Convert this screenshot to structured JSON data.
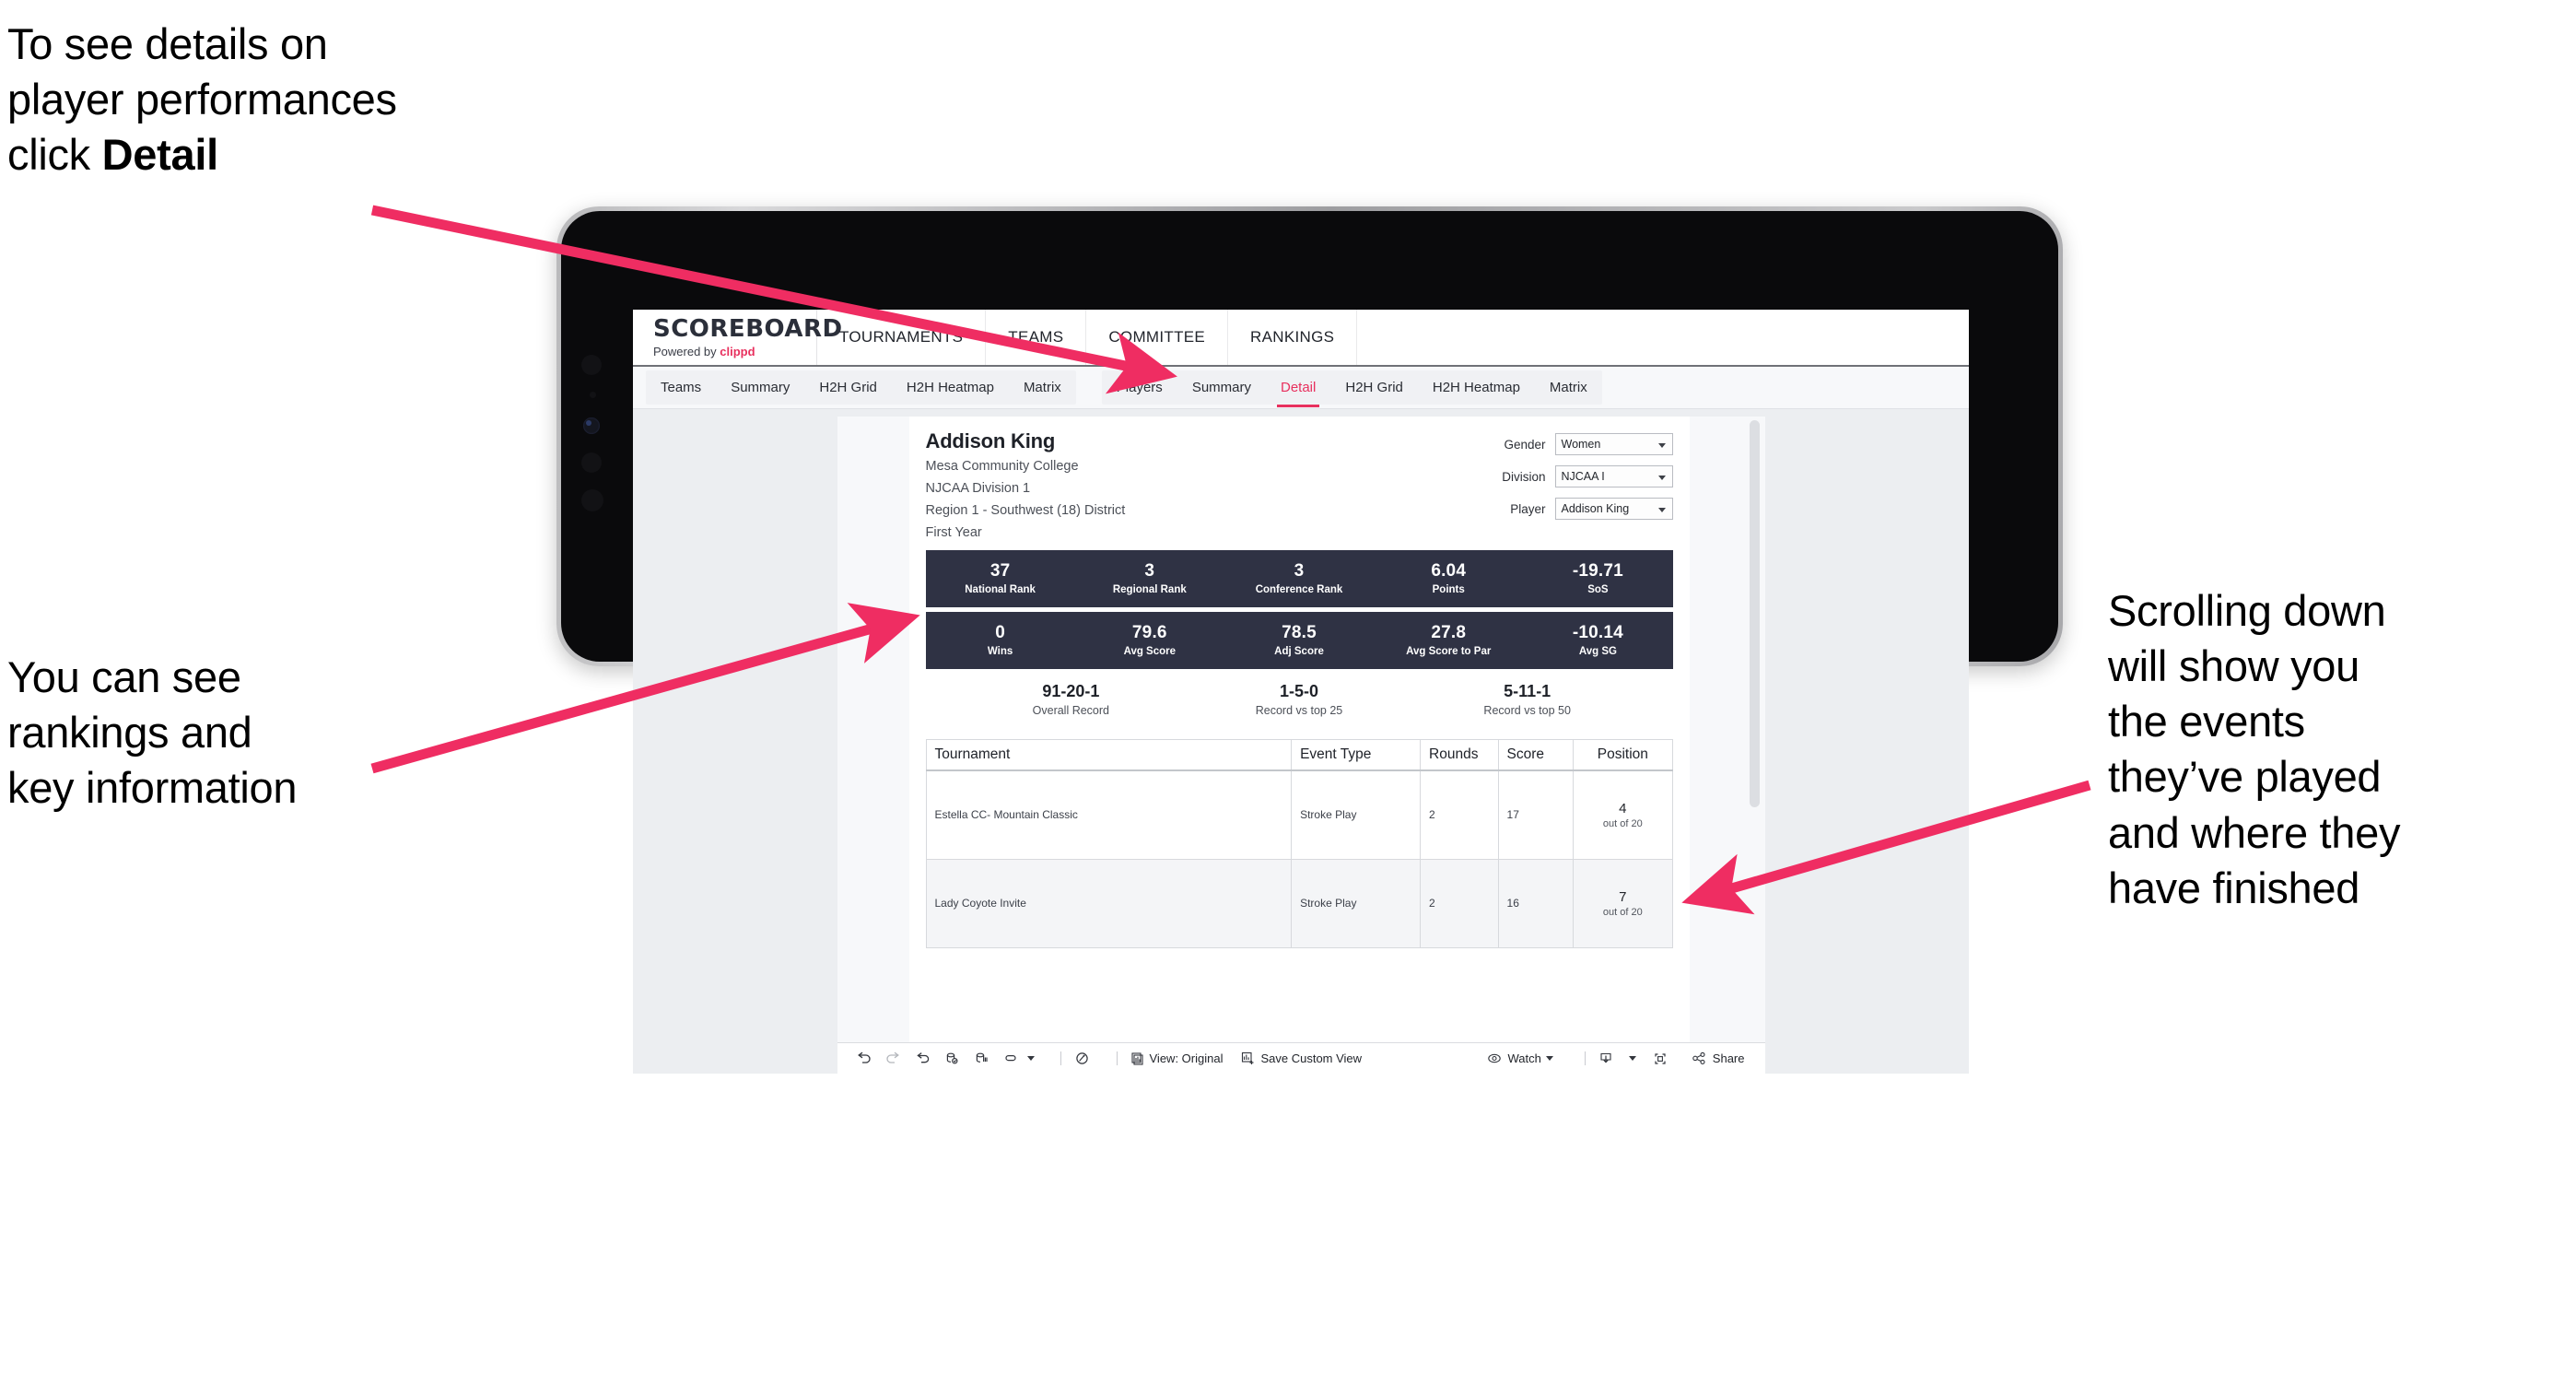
{
  "annotations": {
    "top_left": {
      "line1": "To see details on",
      "line2": "player performances",
      "line3_prefix": "click ",
      "line3_bold": "Detail"
    },
    "mid_left": {
      "line1": "You can see",
      "line2": "rankings and",
      "line3": "key information"
    },
    "right": {
      "line1": "Scrolling down",
      "line2": "will show you",
      "line3": "the events",
      "line4": "they’ve played",
      "line5": "and where they",
      "line6": "have finished"
    },
    "arrow_color": "#ef2d62"
  },
  "app": {
    "brand": {
      "title": "SCOREBOARD",
      "powered_prefix": "Powered by ",
      "powered_name": "clippd"
    },
    "topnav": [
      {
        "label": "TOURNAMENTS"
      },
      {
        "label": "TEAMS"
      },
      {
        "label": "COMMITTEE"
      },
      {
        "label": "RANKINGS"
      }
    ],
    "tabs_teams": [
      {
        "label": "Teams",
        "active": false
      },
      {
        "label": "Summary",
        "active": false
      },
      {
        "label": "H2H Grid",
        "active": false
      },
      {
        "label": "H2H Heatmap",
        "active": false
      },
      {
        "label": "Matrix",
        "active": false
      }
    ],
    "tabs_players": [
      {
        "label": "Players",
        "active": false
      },
      {
        "label": "Summary",
        "active": false
      },
      {
        "label": "Detail",
        "active": true
      },
      {
        "label": "H2H Grid",
        "active": false
      },
      {
        "label": "H2H Heatmap",
        "active": false
      },
      {
        "label": "Matrix",
        "active": false
      }
    ],
    "accent_color": "#e8305e",
    "statbar_color": "#2f3244"
  },
  "player": {
    "name": "Addison King",
    "school": "Mesa Community College",
    "division": "NJCAA Division 1",
    "region": "Region 1 - Southwest (18) District",
    "year": "First Year"
  },
  "filters": [
    {
      "label": "Gender",
      "value": "Women"
    },
    {
      "label": "Division",
      "value": "NJCAA I"
    },
    {
      "label": "Player",
      "value": "Addison King"
    }
  ],
  "stats_row1": [
    {
      "value": "37",
      "label": "National Rank"
    },
    {
      "value": "3",
      "label": "Regional Rank"
    },
    {
      "value": "3",
      "label": "Conference Rank"
    },
    {
      "value": "6.04",
      "label": "Points"
    },
    {
      "value": "-19.71",
      "label": "SoS"
    }
  ],
  "stats_row2": [
    {
      "value": "0",
      "label": "Wins"
    },
    {
      "value": "79.6",
      "label": "Avg Score"
    },
    {
      "value": "78.5",
      "label": "Adj Score"
    },
    {
      "value": "27.8",
      "label": "Avg Score to Par"
    },
    {
      "value": "-10.14",
      "label": "Avg SG"
    }
  ],
  "records": [
    {
      "value": "91-20-1",
      "label": "Overall Record"
    },
    {
      "value": "1-5-0",
      "label": "Record vs top 25"
    },
    {
      "value": "5-11-1",
      "label": "Record vs top 50"
    }
  ],
  "table": {
    "headers": [
      "Tournament",
      "Event Type",
      "Rounds",
      "Score",
      "Position"
    ],
    "rows": [
      {
        "tournament": "Estella CC- Mountain Classic",
        "event_type": "Stroke Play",
        "rounds": "2",
        "score": "17",
        "position_num": "4",
        "position_of": "out of 20"
      },
      {
        "tournament": "Lady Coyote Invite",
        "event_type": "Stroke Play",
        "rounds": "2",
        "score": "16",
        "position_num": "7",
        "position_of": "out of 20"
      }
    ]
  },
  "toolbar": {
    "view_label": "View: Original",
    "save_label": "Save Custom View",
    "watch_label": "Watch",
    "share_label": "Share"
  }
}
